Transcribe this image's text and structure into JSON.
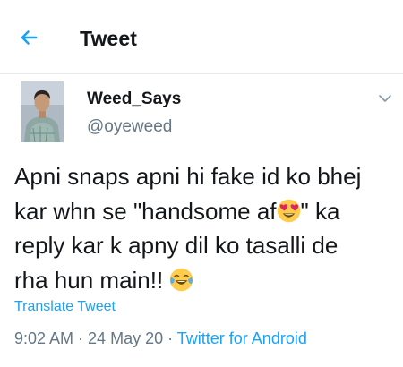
{
  "header": {
    "title": "Tweet"
  },
  "author": {
    "display_name": "Weed_Says",
    "handle": "@oyeweed"
  },
  "tweet": {
    "line1": "Apni snaps apni hi fake id ko bhej",
    "line2_start": "kar whn se \"handsome af",
    "line2_end": "\" ka",
    "line3": "reply kar k apny dil ko tasalli de",
    "line4": "rha hun main!! ",
    "emoji_1": "heart-eyes-emoji",
    "emoji_2": "tears-of-joy-emoji"
  },
  "translate_label": "Translate Tweet",
  "meta": {
    "time": "9:02 AM",
    "sep1": " · ",
    "date": "24 May 20",
    "sep2": " · ",
    "source": "Twitter for Android"
  },
  "colors": {
    "accent": "#1da1f2",
    "text": "#14171a",
    "muted": "#657786"
  }
}
